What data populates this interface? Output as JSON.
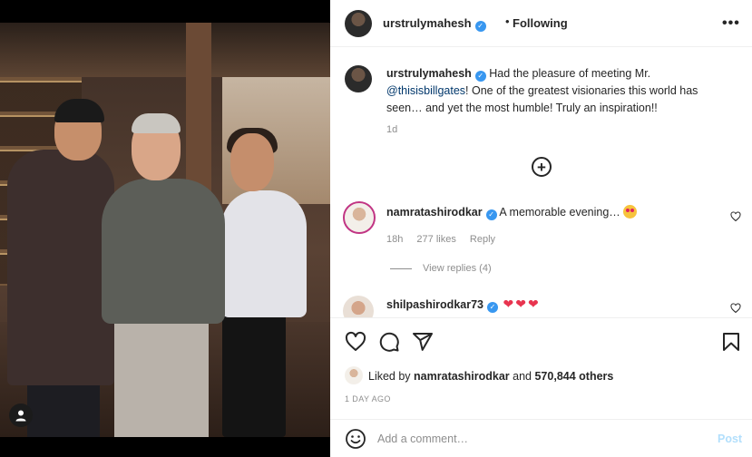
{
  "header": {
    "username": "urstrulymahesh",
    "separator": "•",
    "follow_status": "Following",
    "more": "•••"
  },
  "caption": {
    "username": "urstrulymahesh",
    "text_before": "Had the pleasure of meeting Mr.",
    "mention": "@thisisbillgates",
    "text_after": "! One of the greatest visionaries this world has seen… and yet the most humble! Truly an inspiration!!",
    "time": "1d"
  },
  "load_more_symbol": "+",
  "comments": [
    {
      "username": "namratashirodkar",
      "text": "A memorable evening…",
      "emoji": "star-struck-emoji",
      "time": "18h",
      "likes": "277 likes",
      "reply": "Reply",
      "view_replies": "View replies (4)"
    },
    {
      "username": "shilpashirodkar73",
      "hearts": [
        "❤",
        "❤",
        "❤"
      ]
    }
  ],
  "likes": {
    "prefix": "Liked by",
    "user": "namratashirodkar",
    "connector": "and",
    "others": "570,844 others"
  },
  "post_time": "1 DAY AGO",
  "comment_box": {
    "placeholder": "Add a comment…",
    "post_label": "Post"
  },
  "colors": {
    "verified": "#3897f0",
    "mention": "#00376b",
    "post_button": "#b2dffc",
    "story_ring": "#c13584"
  },
  "icons": [
    "user-tag-icon",
    "more-icon",
    "add-circle-icon",
    "heart-icon",
    "comment-icon",
    "share-icon",
    "bookmark-icon",
    "emoji-icon",
    "verified-icon"
  ]
}
